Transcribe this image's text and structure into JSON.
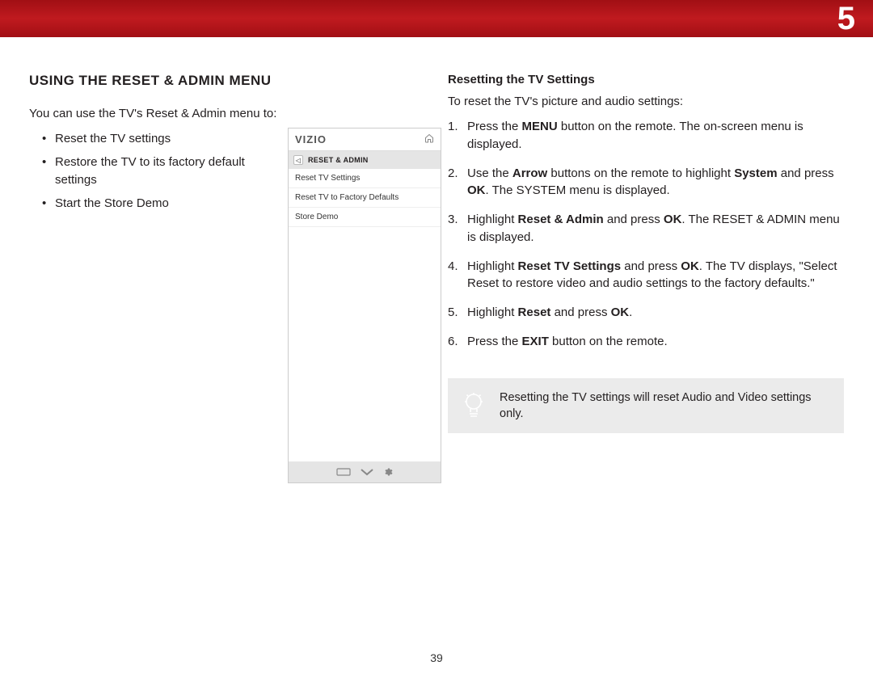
{
  "banner": {
    "chapter": "5"
  },
  "page_number": "39",
  "left": {
    "title": "USING THE RESET & ADMIN MENU",
    "intro": "You can use the TV's Reset & Admin menu to:",
    "bullets": [
      "Reset the TV settings",
      "Restore the TV to its factory default settings",
      "Start the Store Demo"
    ]
  },
  "tv_widget": {
    "brand": "VIZIO",
    "menu_title": "RESET & ADMIN",
    "items": [
      "Reset TV Settings",
      "Reset TV to Factory Defaults",
      "Store Demo"
    ]
  },
  "right": {
    "title": "Resetting the TV Settings",
    "intro": "To reset the TV's picture and audio settings:",
    "steps": [
      {
        "pre": "Press the ",
        "b1": "MENU",
        "mid1": " button on the remote. The on-screen menu is displayed."
      },
      {
        "pre": "Use the ",
        "b1": "Arrow",
        "mid1": " buttons on the remote to highlight ",
        "b2": "System",
        "mid2": " and press ",
        "b3": "OK",
        "mid3": ". The SYSTEM menu is displayed."
      },
      {
        "pre": "Highlight ",
        "b1": "Reset & Admin",
        "mid1": " and press ",
        "b2": "OK",
        "mid2": ". The RESET & ADMIN menu is displayed."
      },
      {
        "pre": "Highlight ",
        "b1": "Reset TV Settings",
        "mid1": " and press ",
        "b2": "OK",
        "mid2": ". The TV displays, \"Select Reset to restore video and audio settings to the factory defaults.\""
      },
      {
        "pre": "Highlight ",
        "b1": "Reset",
        "mid1": " and press ",
        "b2": "OK",
        "mid2": "."
      },
      {
        "pre": "Press the ",
        "b1": "EXIT",
        "mid1": " button on the remote."
      }
    ],
    "tip": "Resetting the TV settings will reset Audio and Video settings only."
  }
}
